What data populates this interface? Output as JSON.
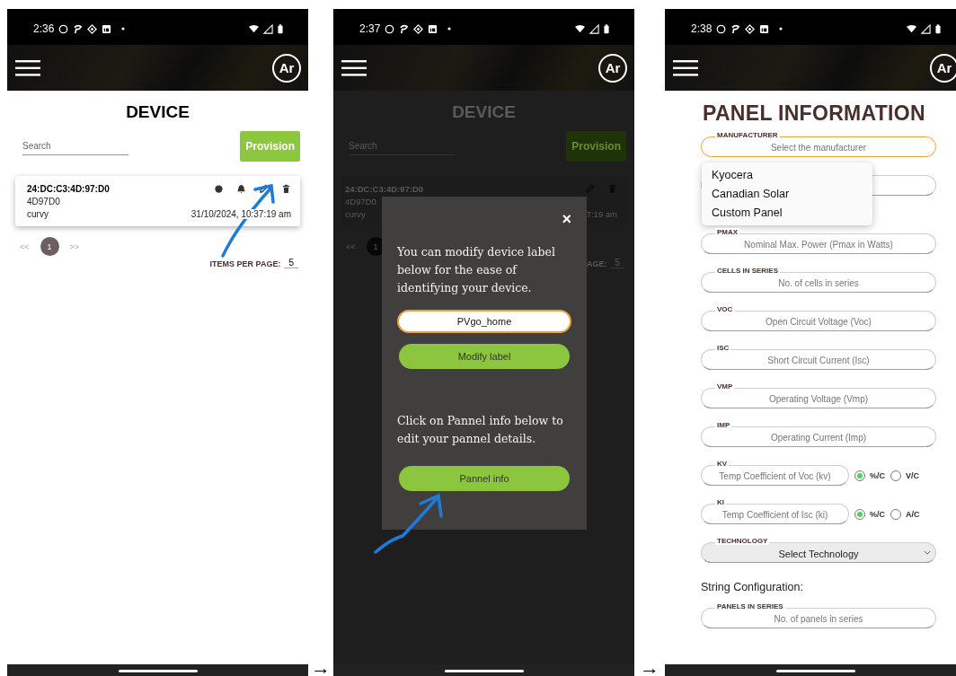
{
  "screens": [
    {
      "kind": "device",
      "time": "2:36",
      "avatar": "Ar",
      "title": "DEVICE",
      "search_placeholder": "Search",
      "provision_button": "Provision",
      "card": {
        "mac": "24:DC:C3:4D:97:D0",
        "serial": "4D97D0",
        "label": "curvy",
        "timestamp": "31/10/2024, 10:37:19 am"
      },
      "pager": {
        "prev": "<<",
        "pages": [
          {
            "label": "1",
            "selected": true
          }
        ],
        "next": ">>"
      },
      "items_label": "ITEMS PER PAGE:",
      "items_value": "5"
    },
    {
      "kind": "device_modal",
      "time": "2:37",
      "avatar": "Ar",
      "background": {
        "title": "DEVICE",
        "search_placeholder": "Search",
        "provision_button": "Provision",
        "mac": "24:DC:C3:4D:97:D0",
        "serial": "4D97D0",
        "label": "curvy",
        "timestamp": "7:19 am",
        "prev": "<<",
        "page": "1",
        "items_label": "AGE:",
        "items_value": "5"
      },
      "modal": {
        "close": "×",
        "intro": "You can modify device label below for the ease of identifying your device.",
        "label_value": "PVgo_home",
        "modify_button": "Modify label",
        "panel_hint": "Click on Pannel info below to edit your pannel details.",
        "panel_button": "Pannel info"
      }
    },
    {
      "kind": "panel_info",
      "time": "2:38",
      "avatar": "Ar",
      "title": "PANEL INFORMATION",
      "fields": [
        {
          "kind": "input",
          "label": "MANUFACTURER",
          "placeholder": "Select the manufacturer",
          "focused": true
        },
        {
          "kind": "covered",
          "focused": false
        },
        {
          "kind": "input",
          "label": "PMAX",
          "placeholder": "Nominal Max. Power (Pmax in Watts)",
          "focused": false
        },
        {
          "kind": "input",
          "label": "CELLS IN SERIES",
          "placeholder": "No. of cells in series",
          "focused": false
        },
        {
          "kind": "input",
          "label": "VOC",
          "placeholder": "Open Circuit Voltage (Voc)",
          "focused": false
        },
        {
          "kind": "input",
          "label": "ISC",
          "placeholder": "Short Circuit Current (Isc)",
          "focused": false
        },
        {
          "kind": "input",
          "label": "VMP",
          "placeholder": "Operating Voltage (Vmp)",
          "focused": false
        },
        {
          "kind": "input",
          "label": "IMP",
          "placeholder": "Operating Current (Imp)",
          "focused": false
        },
        {
          "kind": "radio",
          "label": "KV",
          "placeholder": "Temp Coefficient of Voc (kv)",
          "focused": false,
          "options": [
            {
              "label": "%/C",
              "selected": true
            },
            {
              "label": "V/C",
              "selected": false
            }
          ]
        },
        {
          "kind": "radio",
          "label": "KI",
          "placeholder": "Temp Coefficient of Isc (ki)",
          "focused": false,
          "options": [
            {
              "label": "%/C",
              "selected": true
            },
            {
              "label": "A/C",
              "selected": false
            }
          ]
        },
        {
          "kind": "select",
          "label": "TECHNOLOGY",
          "placeholder": "Select Technology",
          "focused": false
        }
      ],
      "manufacturer_menu": [
        "Kyocera",
        "Canadian Solar",
        "Custom Panel"
      ],
      "section_heading": "String Configuration:",
      "string_fields": [
        {
          "kind": "input",
          "label": "PANELS IN SERIES",
          "placeholder": "No. of panels in series",
          "focused": false
        }
      ]
    }
  ],
  "connectors": [
    "→",
    "→"
  ]
}
